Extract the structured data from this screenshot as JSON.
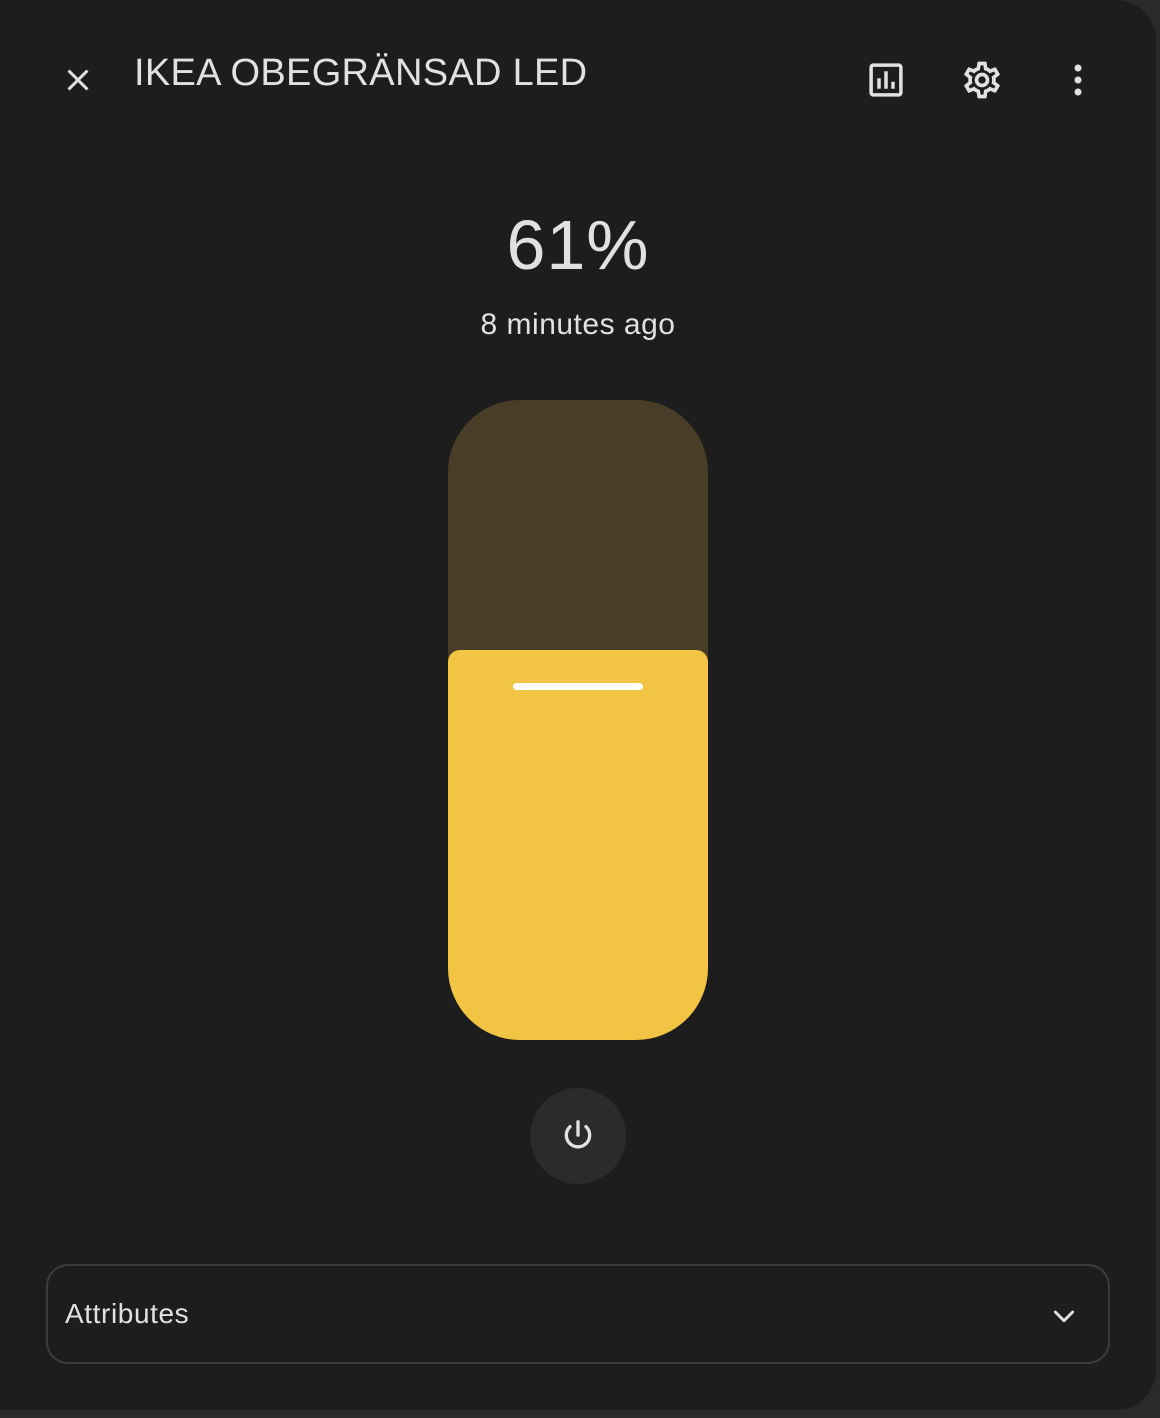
{
  "header": {
    "title": "IKEA OBEGRÄNSAD LED",
    "close_icon": "close-icon",
    "history_icon": "chart-box-icon",
    "settings_icon": "cog-icon",
    "more_icon": "dots-vertical-icon"
  },
  "state": {
    "value": "61%",
    "brightness_fraction": 0.61,
    "last_changed": "8 minutes ago"
  },
  "power": {
    "icon": "power-icon"
  },
  "attributes": {
    "label": "Attributes",
    "icon": "chevron-down-icon"
  },
  "colors": {
    "background": "#1d1d1d",
    "slider_fill": "#f2c444",
    "slider_track": "#493d27",
    "text": "#e1e1e1",
    "power_button_bg": "#2b2b2b"
  }
}
